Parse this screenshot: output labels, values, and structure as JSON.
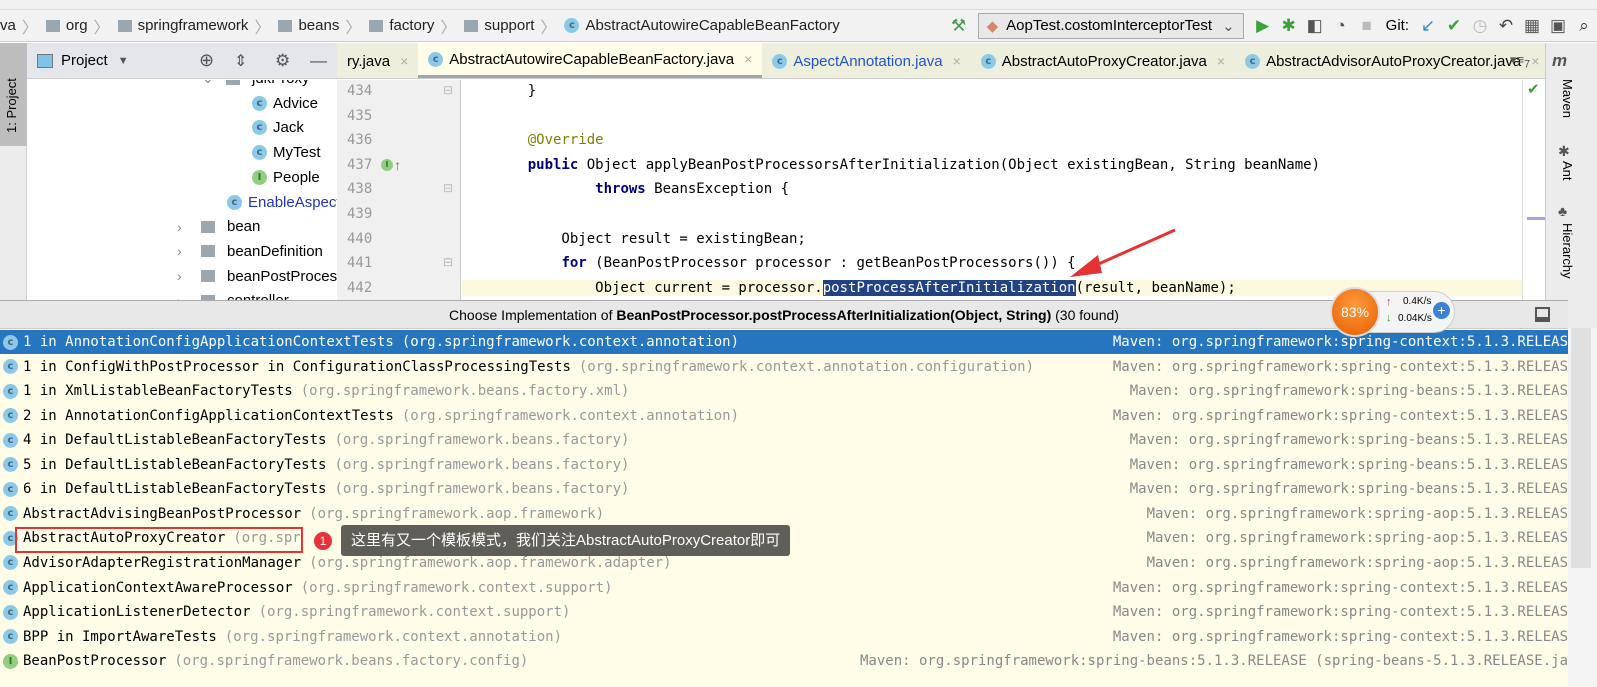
{
  "breadcrumb": [
    "va",
    "org",
    "springframework",
    "beans",
    "factory",
    "support",
    "AbstractAutowireCapableBeanFactory"
  ],
  "toolbar": {
    "run_config": "AopTest.costomInterceptorTest",
    "git_label": "Git:"
  },
  "project_panel": {
    "title": "Project",
    "tool_tab": "1: Project",
    "tree": [
      {
        "label": "jdkProxy",
        "type": "package"
      },
      {
        "label": "Advice",
        "type": "class"
      },
      {
        "label": "Jack",
        "type": "class"
      },
      {
        "label": "MyTest",
        "type": "test-class"
      },
      {
        "label": "People",
        "type": "interface"
      },
      {
        "label": "EnableAspect",
        "type": "class"
      },
      {
        "label": "bean",
        "type": "folder"
      },
      {
        "label": "beanDefinition",
        "type": "folder"
      },
      {
        "label": "beanPostProcess",
        "type": "folder"
      },
      {
        "label": "controller",
        "type": "folder"
      }
    ]
  },
  "tabs": [
    {
      "label": "ry.java"
    },
    {
      "label": "AbstractAutowireCapableBeanFactory.java",
      "active": true
    },
    {
      "label": "AspectAnnotation.java"
    },
    {
      "label": "AbstractAutoProxyCreator.java"
    },
    {
      "label": "AbstractAdvisorAutoProxyCreator.java"
    }
  ],
  "tabs_overflow": "7",
  "editor": {
    "lines": [
      {
        "n": "434",
        "code": "    }"
      },
      {
        "n": "435",
        "code": ""
      },
      {
        "n": "436",
        "code": "    @Override"
      },
      {
        "n": "437",
        "code": "    public Object applyBeanPostProcessorsAfterInitialization(Object existingBean, String beanName)"
      },
      {
        "n": "438",
        "code": "            throws BeansException {"
      },
      {
        "n": "439",
        "code": ""
      },
      {
        "n": "440",
        "code": "        Object result = existingBean;"
      },
      {
        "n": "441",
        "code": "        for (BeanPostProcessor processor : getBeanPostProcessors()) {"
      },
      {
        "n": "442",
        "pre": "            Object current = processor.",
        "selected": "postProcessAfterInitialization",
        "post": "(result, beanName);"
      }
    ]
  },
  "right_tools": [
    "Maven",
    "Ant",
    "Hierarchy"
  ],
  "popup": {
    "title_prefix": "Choose Implementation of ",
    "title_bold": "BeanPostProcessor.postProcessAfterInitialization(Object, String)",
    "title_suffix": " (30 found)",
    "items": [
      {
        "name": "1 in AnnotationConfigApplicationContextTests",
        "pkg": "(org.springframework.context.annotation)",
        "loc": "Maven: org.springframework:spring-context:5.1.3.RELEAS",
        "icon": "class",
        "selected": true
      },
      {
        "name": "1 in ConfigWithPostProcessor in ConfigurationClassProcessingTests",
        "pkg": "(org.springframework.context.annotation.configuration)",
        "loc": "Maven: org.springframework:spring-context:5.1.3.RELEAS",
        "icon": "class"
      },
      {
        "name": "1 in XmlListableBeanFactoryTests",
        "pkg": "(org.springframework.beans.factory.xml)",
        "loc": "Maven: org.springframework:spring-beans:5.1.3.RELEAS",
        "icon": "class"
      },
      {
        "name": "2 in AnnotationConfigApplicationContextTests",
        "pkg": "(org.springframework.context.annotation)",
        "loc": "Maven: org.springframework:spring-context:5.1.3.RELEAS",
        "icon": "class"
      },
      {
        "name": "4 in DefaultListableBeanFactoryTests",
        "pkg": "(org.springframework.beans.factory)",
        "loc": "Maven: org.springframework:spring-beans:5.1.3.RELEAS",
        "icon": "class"
      },
      {
        "name": "5 in DefaultListableBeanFactoryTests",
        "pkg": "(org.springframework.beans.factory)",
        "loc": "Maven: org.springframework:spring-beans:5.1.3.RELEAS",
        "icon": "class"
      },
      {
        "name": "6 in DefaultListableBeanFactoryTests",
        "pkg": "(org.springframework.beans.factory)",
        "loc": "Maven: org.springframework:spring-beans:5.1.3.RELEAS",
        "icon": "class"
      },
      {
        "name": "AbstractAdvisingBeanPostProcessor",
        "pkg": "(org.springframework.aop.framework)",
        "loc": "Maven: org.springframework:spring-aop:5.1.3.RELEAS",
        "icon": "class"
      },
      {
        "name": "AbstractAutoProxyCreator",
        "pkg": "(org.spr",
        "loc": "Maven: org.springframework:spring-aop:5.1.3.RELEAS",
        "icon": "class"
      },
      {
        "name": "AdvisorAdapterRegistrationManager",
        "pkg": "(org.springframework.aop.framework.adapter)",
        "loc": "Maven: org.springframework:spring-aop:5.1.3.RELEAS",
        "icon": "class"
      },
      {
        "name": "ApplicationContextAwareProcessor",
        "pkg": "(org.springframework.context.support)",
        "loc": "Maven: org.springframework:spring-context:5.1.3.RELEAS",
        "icon": "class"
      },
      {
        "name": "ApplicationListenerDetector",
        "pkg": "(org.springframework.context.support)",
        "loc": "Maven: org.springframework:spring-context:5.1.3.RELEAS",
        "icon": "class"
      },
      {
        "name": "BPP in ImportAwareTests",
        "pkg": "(org.springframework.context.annotation)",
        "loc": "Maven: org.springframework:spring-context:5.1.3.RELEAS",
        "icon": "class"
      },
      {
        "name": "BeanPostProcessor",
        "pkg": "(org.springframework.beans.factory.config)",
        "loc": "Maven: org.springframework:spring-beans:5.1.3.RELEASE (spring-beans-5.1.3.RELEASE.ja",
        "icon": "interface"
      }
    ]
  },
  "annotation": {
    "badge": "1",
    "text": "这里有又一个模板模式，我们关注AbstractAutoProxyCreator即可",
    "box_color": "#e53333"
  },
  "net_widget": {
    "percent": "83%",
    "up": "0.4K/s",
    "down": "0.04K/s"
  },
  "colors": {
    "selection": "#2675bf",
    "popup_bg": "#fffde8",
    "code_selection": "#214283"
  }
}
